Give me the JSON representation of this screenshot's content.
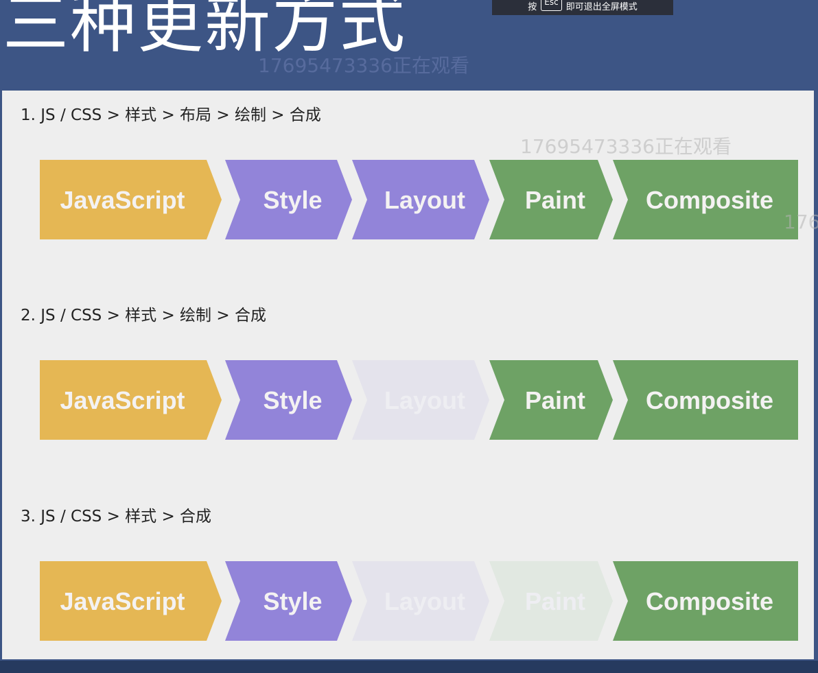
{
  "title": "三种更新方式",
  "esc_tip": {
    "prefix": "按",
    "key": "Esc",
    "suffix": "即可退出全屏模式"
  },
  "watermarks": [
    "17695473336正在观看",
    "17695473336正在观看",
    "176"
  ],
  "colors": {
    "javascript": "#e5b754",
    "style": "#9284d9",
    "layout": "#9284d9",
    "paint": "#6ea265",
    "composite": "#6ea265",
    "skipped_style": "#e4e3ec",
    "skipped_paint": "#e1e8e1",
    "active_text": "#f4f2f2",
    "skipped_text": "#eeeef2"
  },
  "rows": [
    {
      "label": "1. JS / CSS > 样式 > 布局 > 绘制 > 合成",
      "stages": [
        {
          "name": "JavaScript",
          "kind": "javascript",
          "active": true
        },
        {
          "name": "Style",
          "kind": "style",
          "active": true
        },
        {
          "name": "Layout",
          "kind": "layout",
          "active": true
        },
        {
          "name": "Paint",
          "kind": "paint",
          "active": true
        },
        {
          "name": "Composite",
          "kind": "composite",
          "active": true
        }
      ]
    },
    {
      "label": "2. JS / CSS > 样式 > 绘制 > 合成",
      "stages": [
        {
          "name": "JavaScript",
          "kind": "javascript",
          "active": true
        },
        {
          "name": "Style",
          "kind": "style",
          "active": true
        },
        {
          "name": "Layout",
          "kind": "layout",
          "active": false
        },
        {
          "name": "Paint",
          "kind": "paint",
          "active": true
        },
        {
          "name": "Composite",
          "kind": "composite",
          "active": true
        }
      ]
    },
    {
      "label": "3. JS / CSS > 样式 > 合成",
      "stages": [
        {
          "name": "JavaScript",
          "kind": "javascript",
          "active": true
        },
        {
          "name": "Style",
          "kind": "style",
          "active": true
        },
        {
          "name": "Layout",
          "kind": "layout",
          "active": false
        },
        {
          "name": "Paint",
          "kind": "paint",
          "active": false
        },
        {
          "name": "Composite",
          "kind": "composite",
          "active": true
        }
      ]
    }
  ]
}
